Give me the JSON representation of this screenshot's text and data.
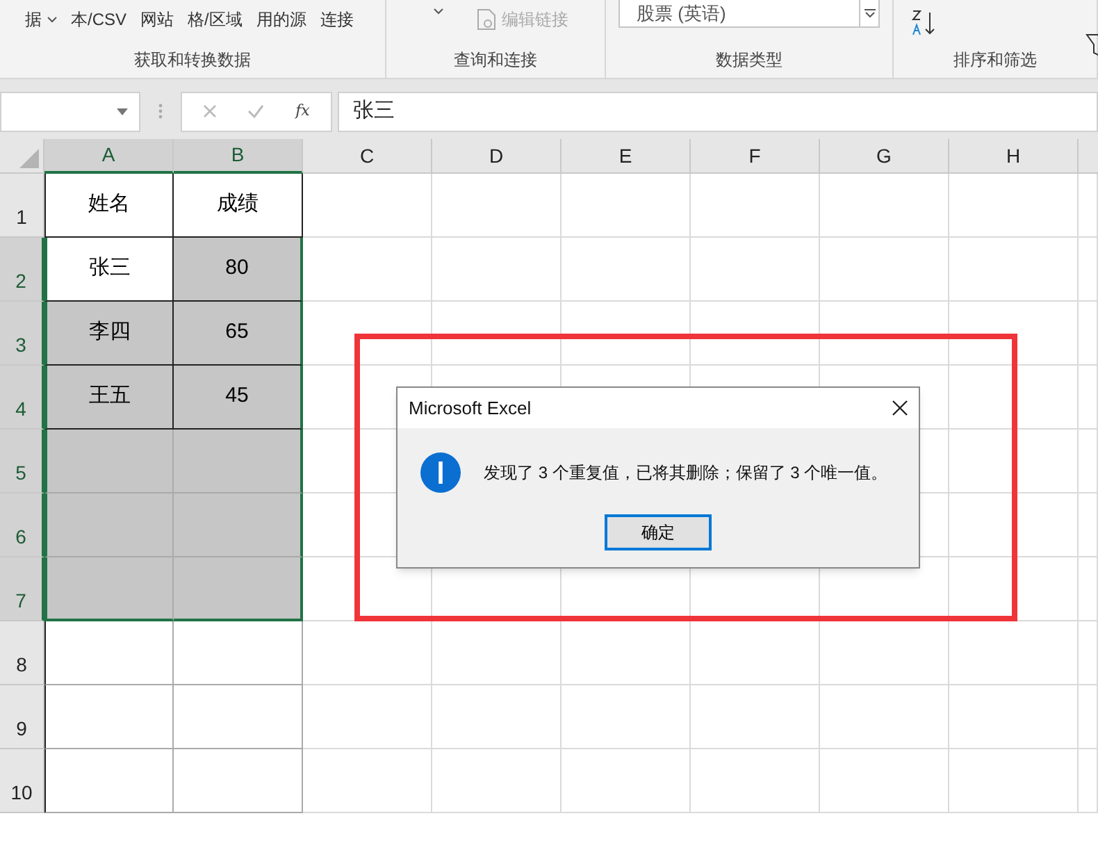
{
  "ribbon": {
    "groups": [
      {
        "label": "获取和转换数据",
        "buttons": [
          {
            "label": "据",
            "dropdown": true
          },
          {
            "label": "本/CSV",
            "dropdown": false
          },
          {
            "label": "网站",
            "dropdown": false
          },
          {
            "label": "格/区域",
            "dropdown": false
          },
          {
            "label": "用的源",
            "dropdown": false
          },
          {
            "label": "连接",
            "dropdown": false
          }
        ]
      },
      {
        "label": "查询和连接",
        "buttons": [
          {
            "dropdown": true
          },
          {
            "label": "编辑链接",
            "dropdown": false,
            "disabled": true
          }
        ]
      },
      {
        "label": "数据类型",
        "combo": "股票 (英语)"
      },
      {
        "label": "排序和筛选"
      }
    ]
  },
  "formula_bar": {
    "cell_value": "张三",
    "fx": "fx"
  },
  "columns": [
    {
      "label": "A",
      "selected": true
    },
    {
      "label": "B",
      "selected": true
    },
    {
      "label": "C",
      "selected": false
    },
    {
      "label": "D",
      "selected": false
    },
    {
      "label": "E",
      "selected": false
    },
    {
      "label": "F",
      "selected": false
    },
    {
      "label": "G",
      "selected": false
    },
    {
      "label": "H",
      "selected": false
    }
  ],
  "rows": [
    {
      "number": "1",
      "selected": false,
      "cells": [
        {
          "text": "姓名",
          "selected": false,
          "active": false
        },
        {
          "text": "成绩",
          "selected": false,
          "active": false
        }
      ]
    },
    {
      "number": "2",
      "selected": true,
      "cells": [
        {
          "text": "张三",
          "selected": true,
          "active": true
        },
        {
          "text": "80",
          "selected": true,
          "active": false
        }
      ]
    },
    {
      "number": "3",
      "selected": true,
      "cells": [
        {
          "text": "李四",
          "selected": true,
          "active": false
        },
        {
          "text": "65",
          "selected": true,
          "active": false
        }
      ]
    },
    {
      "number": "4",
      "selected": true,
      "cells": [
        {
          "text": "王五",
          "selected": true,
          "active": false
        },
        {
          "text": "45",
          "selected": true,
          "active": false
        }
      ]
    },
    {
      "number": "5",
      "selected": true,
      "cells": [
        {
          "selected": true,
          "active": false
        },
        {
          "selected": true,
          "active": false
        }
      ]
    },
    {
      "number": "6",
      "selected": true,
      "cells": [
        {
          "selected": true,
          "active": false
        },
        {
          "selected": true,
          "active": false
        }
      ]
    },
    {
      "number": "7",
      "selected": true,
      "cells": [
        {
          "selected": true,
          "active": false
        },
        {
          "selected": true,
          "active": false
        }
      ]
    },
    {
      "number": "8",
      "selected": false,
      "cells": [
        {
          "selected": false,
          "active": false
        },
        {
          "selected": false,
          "active": false
        }
      ]
    },
    {
      "number": "9",
      "selected": false,
      "cells": [
        {
          "selected": false,
          "active": false
        },
        {
          "selected": false,
          "active": false
        }
      ]
    },
    {
      "number": "10",
      "selected": false,
      "cells": [
        {
          "selected": false,
          "active": false
        },
        {
          "selected": false,
          "active": false
        }
      ]
    }
  ],
  "dialog": {
    "title": "Microsoft Excel",
    "message": "发现了 3 个重复值，已将其删除；保留了 3 个唯一值。",
    "button": "确定",
    "highlighted": true
  }
}
